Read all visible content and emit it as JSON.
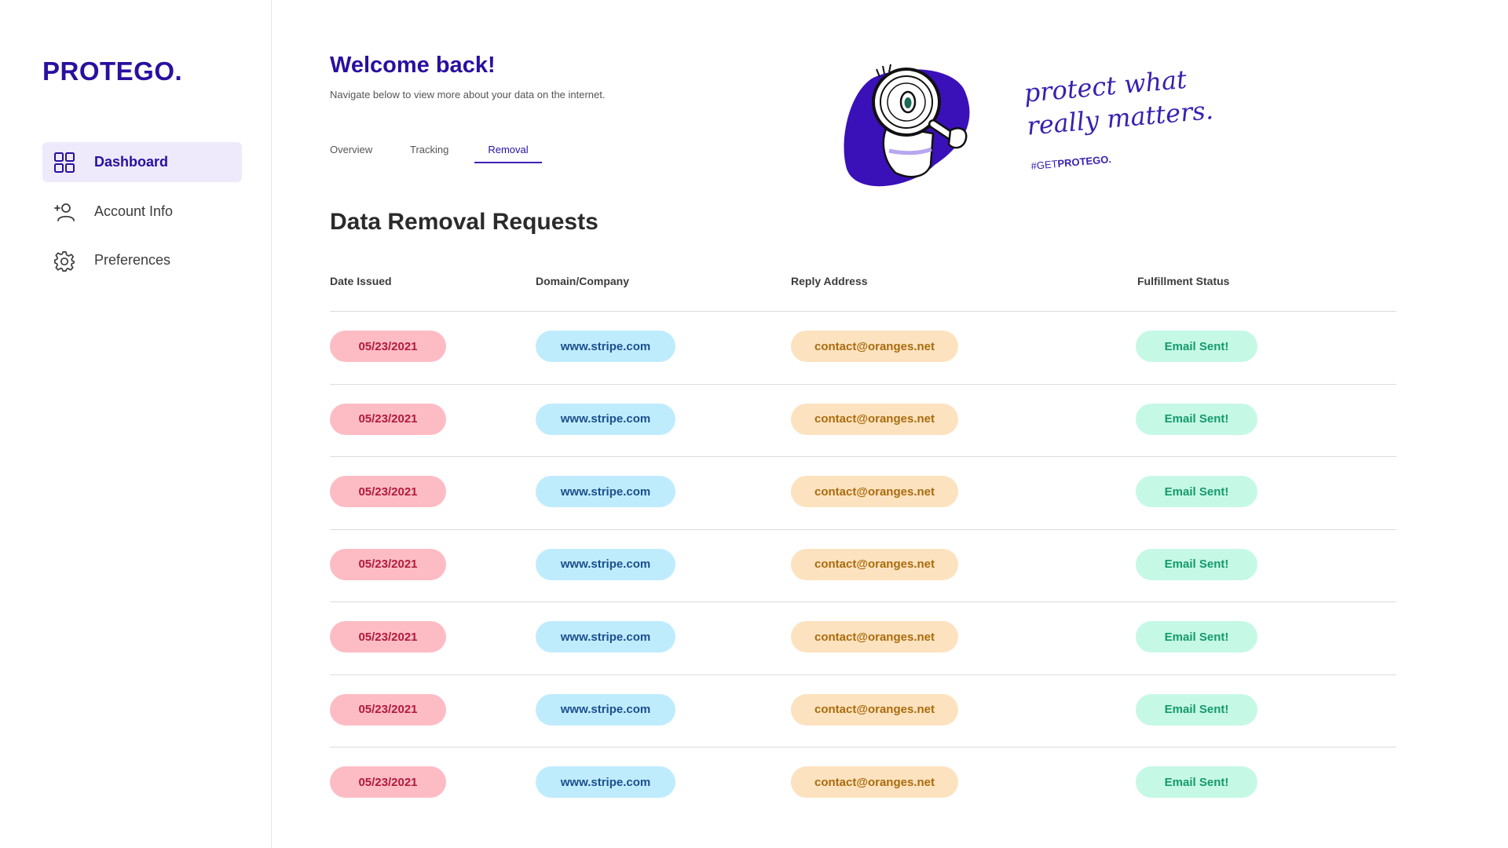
{
  "brand": {
    "logo": "PROTEGO.",
    "accent": "#2a0fa0"
  },
  "sidebar": {
    "items": [
      {
        "label": "Dashboard",
        "icon": "grid-icon",
        "active": true
      },
      {
        "label": "Account Info",
        "icon": "user-add-icon",
        "active": false
      },
      {
        "label": "Preferences",
        "icon": "gear-icon",
        "active": false
      }
    ]
  },
  "header": {
    "title": "Welcome back!",
    "subtitle": "Navigate below to view more about your data on the internet."
  },
  "tabs": [
    {
      "label": "Overview",
      "active": false
    },
    {
      "label": "Tracking",
      "active": false
    },
    {
      "label": "Removal",
      "active": true
    }
  ],
  "banner": {
    "tagline_line1": "protect what",
    "tagline_line2": "really matters.",
    "hashtag_prefix": "#GET",
    "hashtag_brand": "PROTEGO."
  },
  "section": {
    "title": "Data Removal Requests"
  },
  "table": {
    "headers": [
      "Date Issued",
      "Domain/Company",
      "Reply Address",
      "Fulfillment Status"
    ],
    "rows": [
      {
        "date": "05/23/2021",
        "domain": "www.stripe.com",
        "reply": "contact@oranges.net",
        "status": "Email Sent!"
      },
      {
        "date": "05/23/2021",
        "domain": "www.stripe.com",
        "reply": "contact@oranges.net",
        "status": "Email Sent!"
      },
      {
        "date": "05/23/2021",
        "domain": "www.stripe.com",
        "reply": "contact@oranges.net",
        "status": "Email Sent!"
      },
      {
        "date": "05/23/2021",
        "domain": "www.stripe.com",
        "reply": "contact@oranges.net",
        "status": "Email Sent!"
      },
      {
        "date": "05/23/2021",
        "domain": "www.stripe.com",
        "reply": "contact@oranges.net",
        "status": "Email Sent!"
      },
      {
        "date": "05/23/2021",
        "domain": "www.stripe.com",
        "reply": "contact@oranges.net",
        "status": "Email Sent!"
      },
      {
        "date": "05/23/2021",
        "domain": "www.stripe.com",
        "reply": "contact@oranges.net",
        "status": "Email Sent!"
      }
    ]
  },
  "colors": {
    "date_pill_bg": "#fdbcc4",
    "domain_pill_bg": "#bfecfd",
    "reply_pill_bg": "#fde2bf",
    "status_pill_bg": "#c6f8e6"
  }
}
